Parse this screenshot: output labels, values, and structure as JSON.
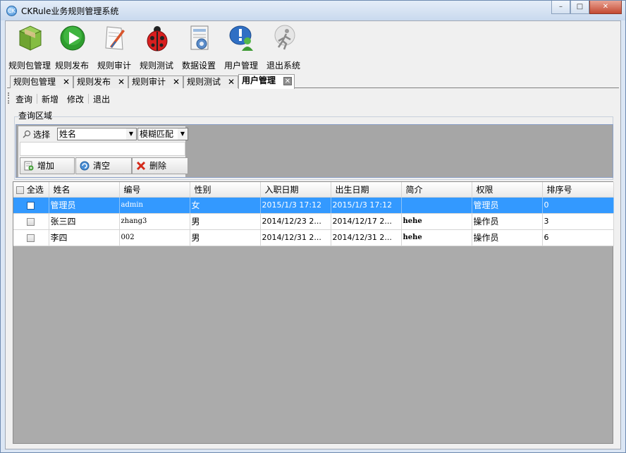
{
  "window": {
    "title": "CKRule业务规则管理系统",
    "icon_text": "CK",
    "buttons": {
      "minimize": "–",
      "maximize": "□",
      "close": "✕"
    }
  },
  "toolbar": {
    "items": [
      {
        "label": "规则包管理",
        "icon": "package-icon"
      },
      {
        "label": "规则发布",
        "icon": "play-icon"
      },
      {
        "label": "规则审计",
        "icon": "audit-icon"
      },
      {
        "label": "规则测试",
        "icon": "ladybug-icon"
      },
      {
        "label": "数据设置",
        "icon": "data-settings-icon"
      },
      {
        "label": "用户管理",
        "icon": "user-management-icon"
      },
      {
        "label": "退出系统",
        "icon": "exit-icon"
      }
    ]
  },
  "tabs": [
    {
      "label": "规则包管理",
      "active": false
    },
    {
      "label": "规则发布",
      "active": false
    },
    {
      "label": "规则审计",
      "active": false
    },
    {
      "label": "规则测试",
      "active": false
    },
    {
      "label": "用户管理",
      "active": true
    }
  ],
  "subtoolbar": {
    "query": "查询",
    "add": "新增",
    "edit": "修改",
    "exit": "退出"
  },
  "query": {
    "group_label": "查询区域",
    "select_label": "选择",
    "field_value": "姓名",
    "match_value": "模糊匹配",
    "text_value": "",
    "buttons": {
      "add": "增加",
      "clear": "清空",
      "delete": "删除"
    }
  },
  "grid": {
    "headers": [
      "全选",
      "姓名",
      "编号",
      "性别",
      "入职日期",
      "出生日期",
      "简介",
      "权限",
      "排序号"
    ],
    "rows": [
      {
        "selected": true,
        "name": "管理员",
        "code": "admin",
        "gender": "女",
        "hire": "2015/1/3 17:12",
        "birth": "2015/1/3 17:12",
        "intro": "",
        "role": "管理员",
        "order": "0"
      },
      {
        "selected": false,
        "name": "张三四",
        "code": "zhang3",
        "gender": "男",
        "hire": "2014/12/23 2...",
        "birth": "2014/12/17 2...",
        "intro": "hehe",
        "role": "操作员",
        "order": "3"
      },
      {
        "selected": false,
        "name": "李四",
        "code": "002",
        "gender": "男",
        "hire": "2014/12/31 2...",
        "birth": "2014/12/31 2...",
        "intro": "hehe",
        "role": "操作员",
        "order": "6"
      }
    ]
  }
}
